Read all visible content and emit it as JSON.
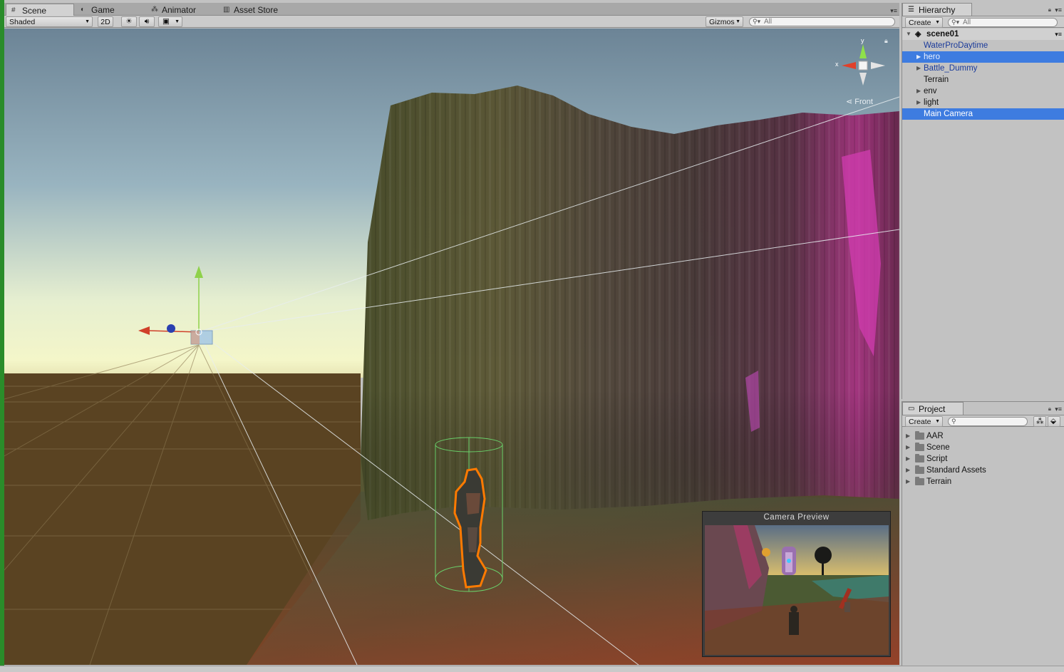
{
  "scene_panel": {
    "tabs": [
      {
        "label": "Scene",
        "icon": "grid-icon",
        "active": true
      },
      {
        "label": "Game",
        "icon": "pacman-icon",
        "active": false
      },
      {
        "label": "Animator",
        "icon": "animator-icon",
        "active": false
      },
      {
        "label": "Asset Store",
        "icon": "store-icon",
        "active": false
      }
    ],
    "toolbar": {
      "shading_mode": "Shaded",
      "mode_2d": "2D",
      "gizmos_label": "Gizmos",
      "search_placeholder": "All"
    },
    "orientation_gizmo": {
      "axis_y": "y",
      "axis_x": "x",
      "view_label": "Front"
    },
    "camera_preview": {
      "title": "Camera Preview"
    }
  },
  "hierarchy": {
    "title": "Hierarchy",
    "create_label": "Create",
    "search_placeholder": "All",
    "scene_name": "scene01",
    "items": [
      {
        "label": "WaterProDaytime",
        "prefab": true,
        "expandable": false,
        "selected": false
      },
      {
        "label": "hero",
        "prefab": true,
        "expandable": true,
        "selected": true
      },
      {
        "label": "Battle_Dummy",
        "prefab": true,
        "expandable": true,
        "selected": false
      },
      {
        "label": "Terrain",
        "prefab": false,
        "expandable": false,
        "selected": false
      },
      {
        "label": "env",
        "prefab": false,
        "expandable": true,
        "selected": false
      },
      {
        "label": "light",
        "prefab": false,
        "expandable": true,
        "selected": false
      },
      {
        "label": "Main Camera",
        "prefab": false,
        "expandable": false,
        "selected": true
      }
    ]
  },
  "project": {
    "title": "Project",
    "create_label": "Create",
    "folders": [
      "AAR",
      "Scene",
      "Script",
      "Standard Assets",
      "Terrain"
    ]
  },
  "colors": {
    "selection": "#3e7ce0",
    "prefab_text": "#1a3a9a",
    "panel_bg": "#c2c2c2",
    "outline_orange": "#ff7a00"
  }
}
